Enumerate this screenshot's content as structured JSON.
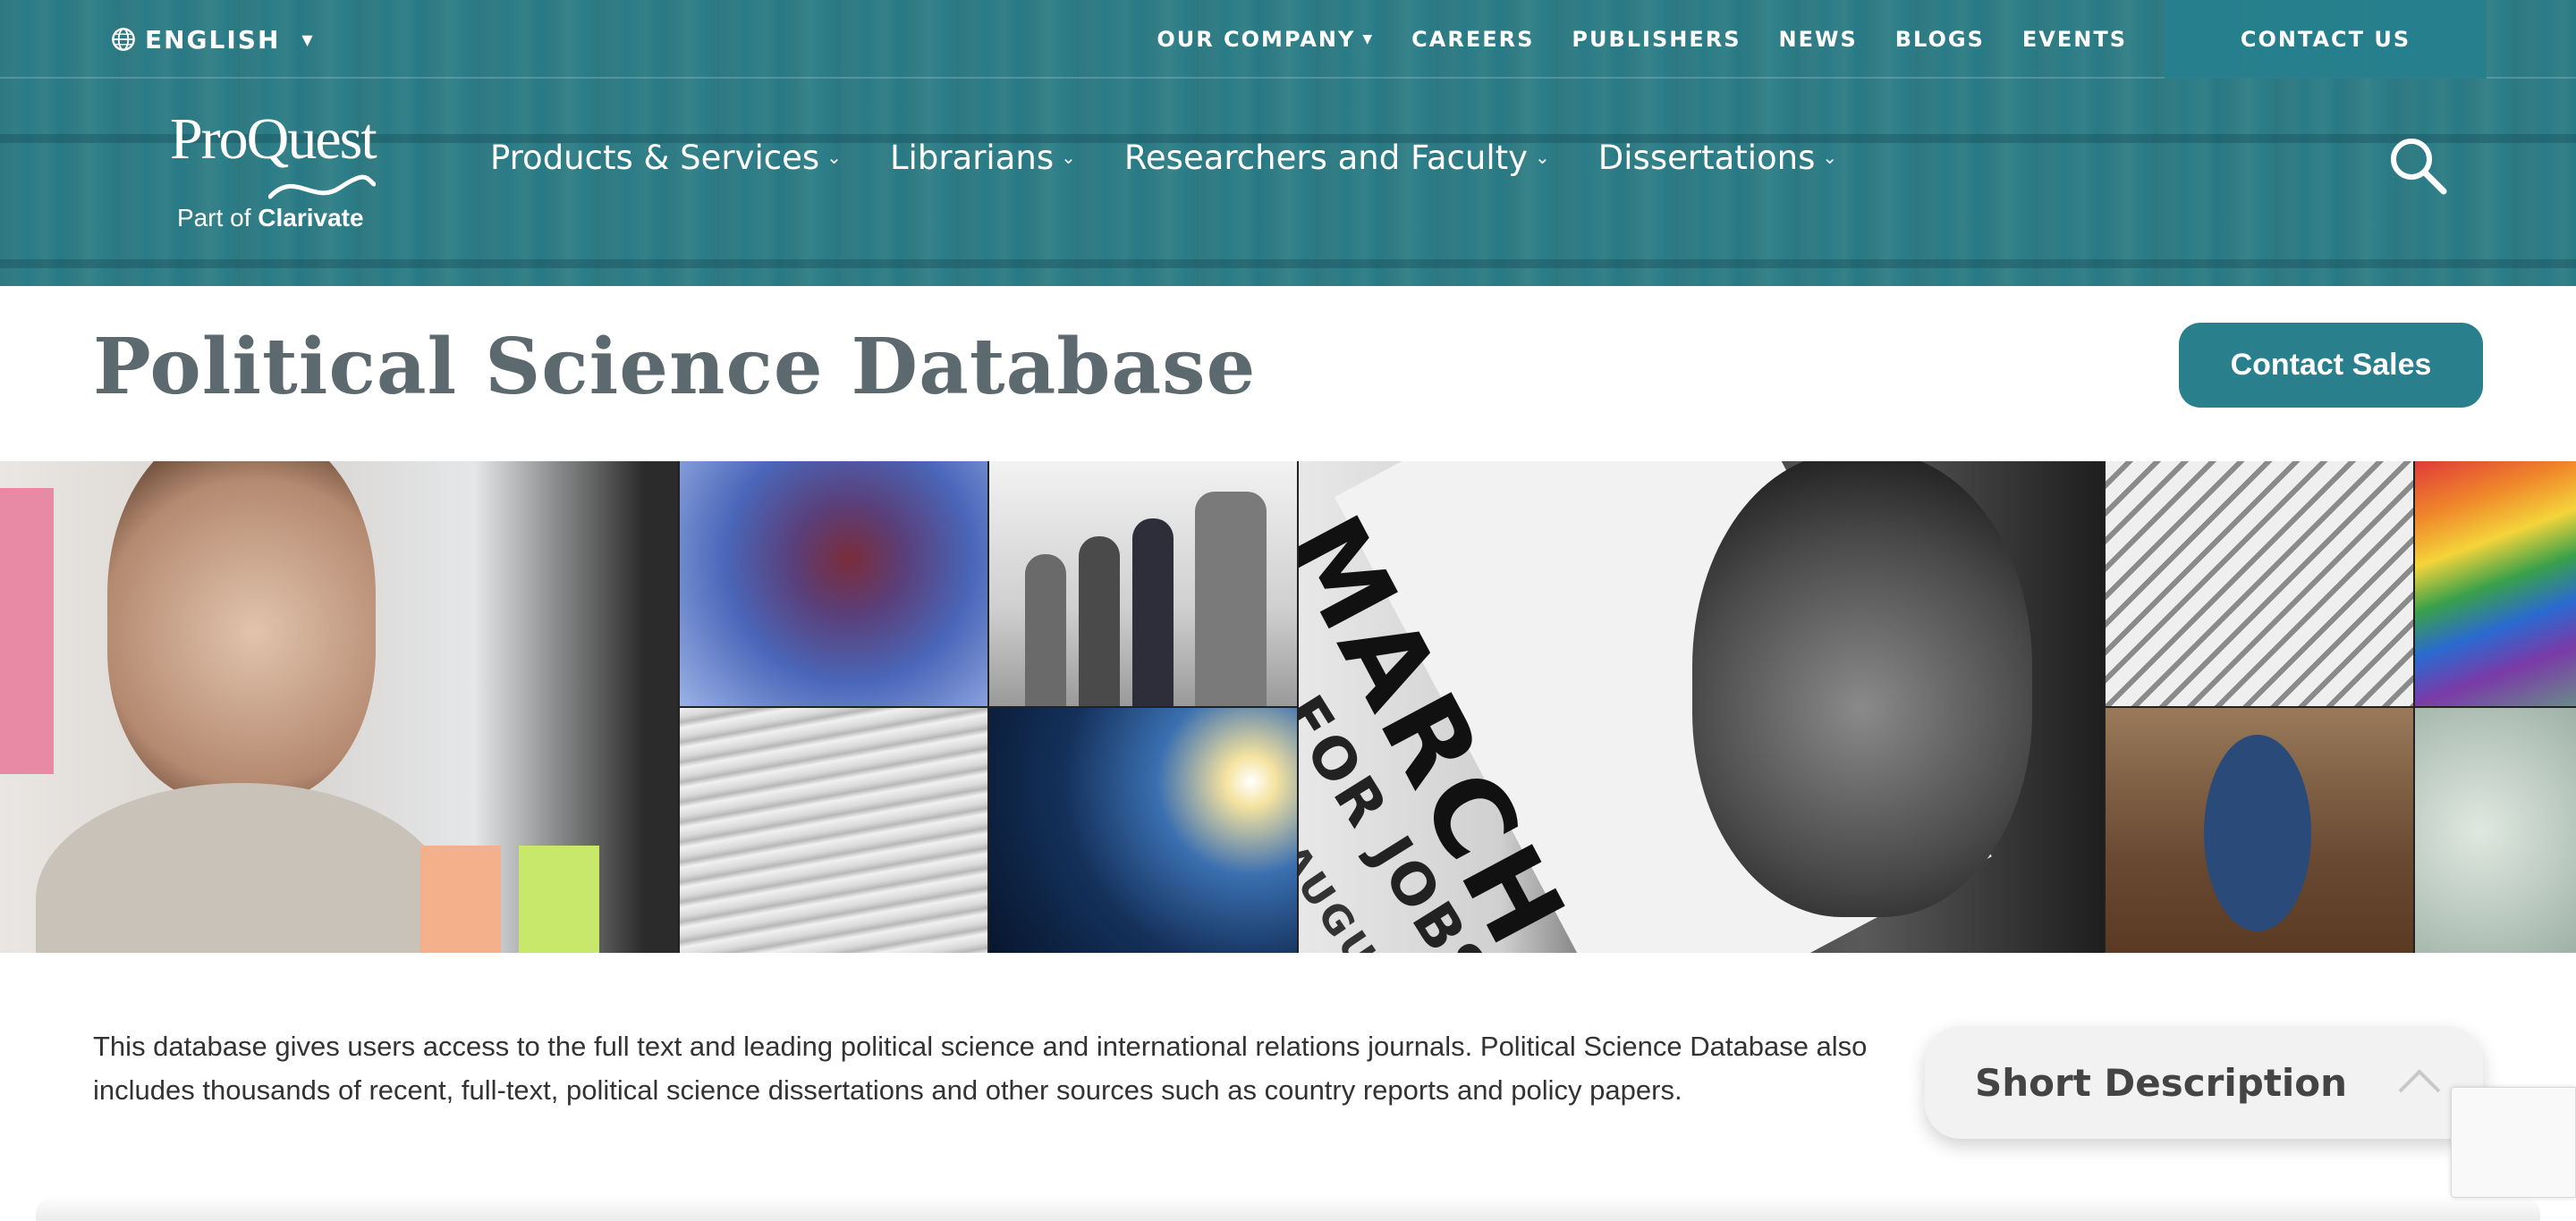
{
  "header": {
    "language": "ENGLISH",
    "top_links": [
      "OUR COMPANY",
      "CAREERS",
      "PUBLISHERS",
      "NEWS",
      "BLOGS",
      "EVENTS"
    ],
    "contact_us": "CONTACT US",
    "logo": {
      "name": "ProQuest",
      "part_of": "Part of",
      "parent": "Clarivate"
    },
    "main_nav": [
      "Products & Services",
      "Librarians",
      "Researchers and Faculty",
      "Dissertations"
    ],
    "search_icon": "search-icon",
    "accent_color": "#2a7f8c"
  },
  "page": {
    "title": "Political Science Database",
    "contact_sales": "Contact Sales"
  },
  "hero": {
    "sign_line1": "MARCH",
    "sign_line2": "FOR JOBS",
    "sign_line3": "AUGUST"
  },
  "description": {
    "text": "This database gives users access to the full text and leading political science and international relations journals. Political Science Database also includes thousands of recent, full-text, political science dissertations and other sources such as country reports and policy papers.",
    "short_description_label": "Short Description"
  }
}
